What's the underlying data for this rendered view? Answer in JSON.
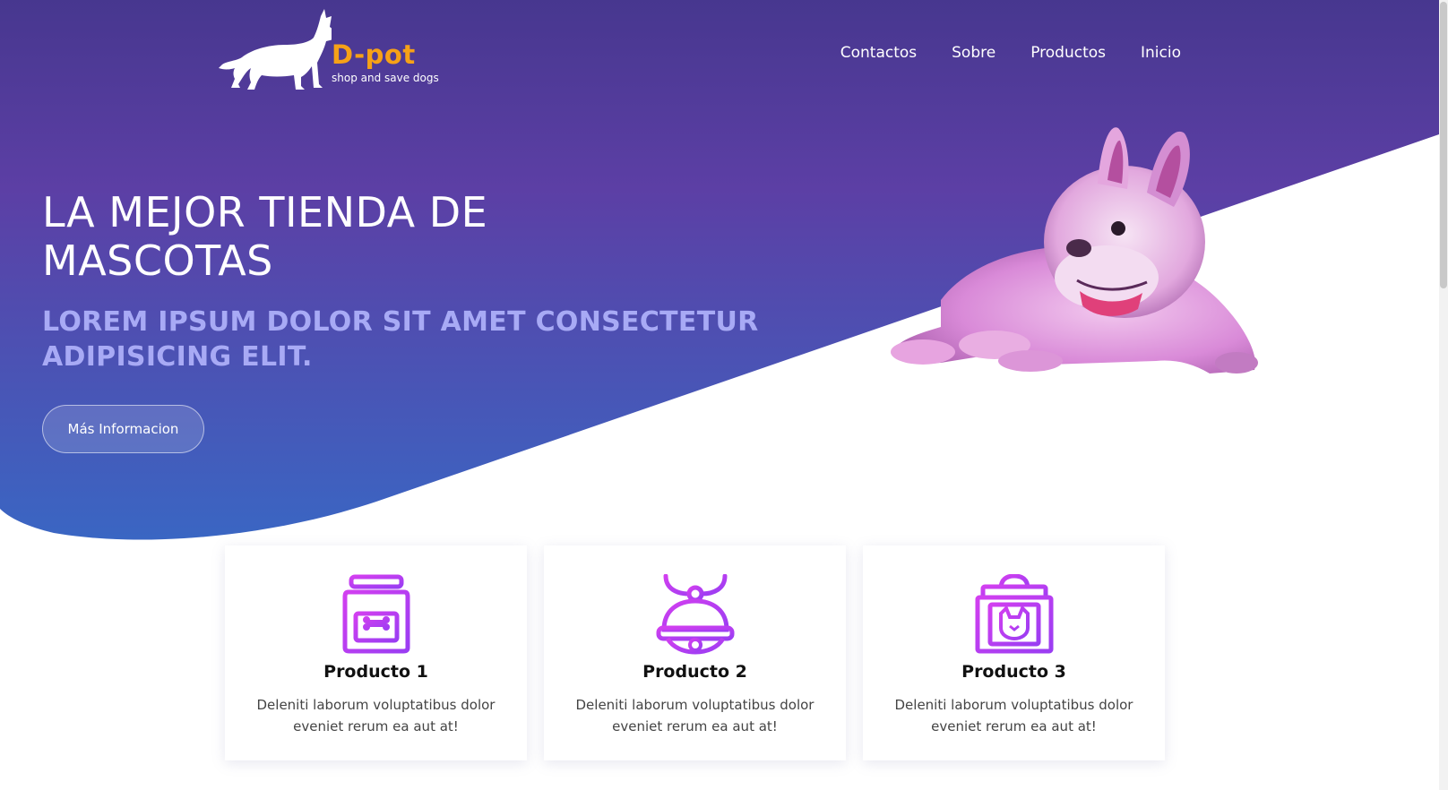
{
  "brand": {
    "name": "D-pot",
    "tagline": "shop and save dogs",
    "accent_color": "#f6a117"
  },
  "nav": {
    "items": [
      {
        "label": "Contactos"
      },
      {
        "label": "Sobre"
      },
      {
        "label": "Productos"
      },
      {
        "label": "Inicio"
      }
    ]
  },
  "hero": {
    "title": "LA MEJOR TIENDA DE MASCOTAS",
    "subtitle": "LOREM IPSUM DOLOR SIT AMET CONSECTETUR ADIPISICING ELIT.",
    "button_label": "Más Informacion",
    "gradient_top": "#4a3592",
    "gradient_mid": "#5b3fa3",
    "gradient_bottom": "#3c68c2"
  },
  "products": [
    {
      "title": "Producto 1",
      "text": "Deleniti laborum voluptatibus dolor eveniet rerum ea aut at!",
      "icon": "dog-food-bag-icon"
    },
    {
      "title": "Producto 2",
      "text": "Deleniti laborum voluptatibus dolor eveniet rerum ea aut at!",
      "icon": "pet-bell-collar-icon"
    },
    {
      "title": "Producto 3",
      "text": "Deleniti laborum voluptatibus dolor eveniet rerum ea aut at!",
      "icon": "pet-carrier-icon"
    }
  ],
  "icon_gradient": [
    "#c63cf0",
    "#9a3df2"
  ]
}
